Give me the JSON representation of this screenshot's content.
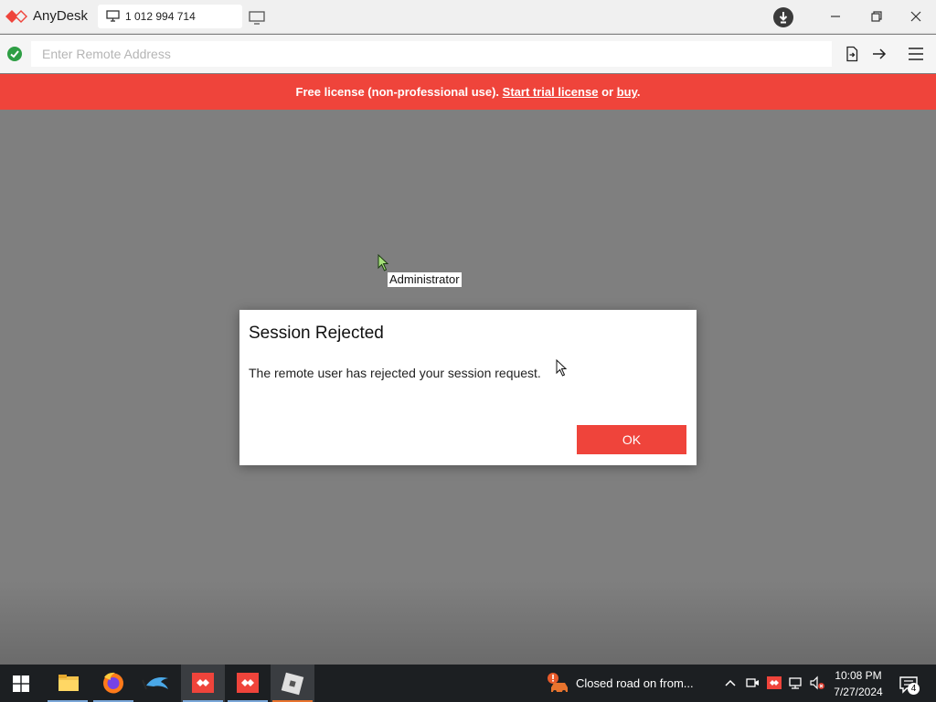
{
  "titlebar": {
    "app_name": "AnyDesk",
    "tab_label": "1 012 994 714"
  },
  "addressbar": {
    "placeholder": "Enter Remote Address"
  },
  "banner": {
    "text_before": "Free license (non-professional use).",
    "trial_link": "Start trial license",
    "or_text": "or",
    "buy_link": "buy",
    "end": "."
  },
  "remote": {
    "cursor_label": "Administrator"
  },
  "dialog": {
    "title": "Session Rejected",
    "message": "The remote user has rejected your session request.",
    "ok_label": "OK"
  },
  "taskbar": {
    "news_text": "Closed road on from...",
    "clock_time": "10:08 PM",
    "clock_date": "7/27/2024",
    "notification_count": "4"
  },
  "colors": {
    "accent": "#ef443b",
    "status_ok": "#2e9e44",
    "remote_bg": "#7f7f7f",
    "taskbar_bg": "#1c1f22"
  },
  "icons": [
    "anydesk-logo-icon",
    "monitor-icon",
    "new-tab-icon",
    "download-icon",
    "minimize-icon",
    "restore-icon",
    "close-icon",
    "status-ok-icon",
    "file-transfer-icon",
    "connect-arrow-icon",
    "menu-icon",
    "windows-start-icon",
    "file-explorer-icon",
    "firefox-icon",
    "dolphin-icon",
    "anydesk-icon",
    "roblox-icon",
    "closed-road-icon",
    "chevron-up-icon",
    "meet-now-icon",
    "anydesk-tray-icon",
    "network-icon",
    "volume-muted-icon",
    "notification-icon"
  ]
}
